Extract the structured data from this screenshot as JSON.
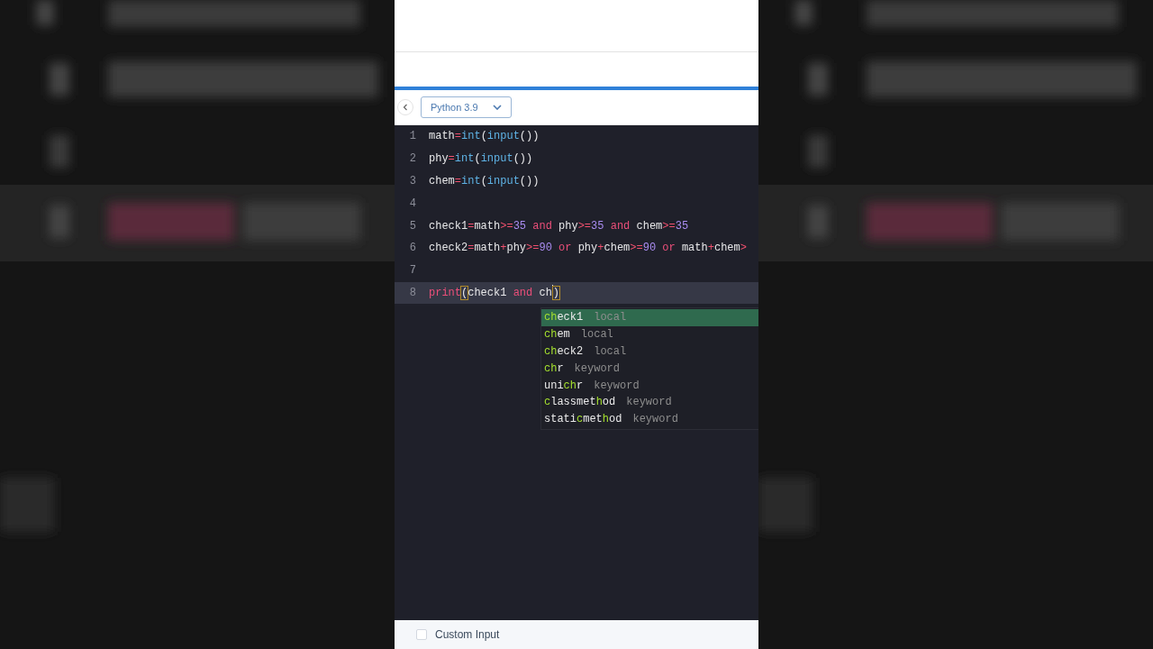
{
  "toolbar": {
    "language": "Python 3.9"
  },
  "editor": {
    "lines": [
      {
        "number": "1",
        "current": false,
        "tokens": [
          {
            "text": "math",
            "kind": "name"
          },
          {
            "text": "=",
            "kind": "op"
          },
          {
            "text": "int",
            "kind": "builtin"
          },
          {
            "text": "(",
            "kind": "paren"
          },
          {
            "text": "input",
            "kind": "builtin"
          },
          {
            "text": "())",
            "kind": "paren"
          }
        ]
      },
      {
        "number": "2",
        "current": false,
        "tokens": [
          {
            "text": "phy",
            "kind": "name"
          },
          {
            "text": "=",
            "kind": "op"
          },
          {
            "text": "int",
            "kind": "builtin"
          },
          {
            "text": "(",
            "kind": "paren"
          },
          {
            "text": "input",
            "kind": "builtin"
          },
          {
            "text": "())",
            "kind": "paren"
          }
        ]
      },
      {
        "number": "3",
        "current": false,
        "tokens": [
          {
            "text": "chem",
            "kind": "name"
          },
          {
            "text": "=",
            "kind": "op"
          },
          {
            "text": "int",
            "kind": "builtin"
          },
          {
            "text": "(",
            "kind": "paren"
          },
          {
            "text": "input",
            "kind": "builtin"
          },
          {
            "text": "())",
            "kind": "paren"
          }
        ]
      },
      {
        "number": "4",
        "current": false
      },
      {
        "number": "5",
        "current": false,
        "tokens": [
          {
            "text": "check1",
            "kind": "name"
          },
          {
            "text": "=",
            "kind": "op"
          },
          {
            "text": "math",
            "kind": "name"
          },
          {
            "text": ">=",
            "kind": "op"
          },
          {
            "text": "35",
            "kind": "number"
          },
          {
            "text": " and ",
            "kind": "keyword"
          },
          {
            "text": "phy",
            "kind": "name"
          },
          {
            "text": ">=",
            "kind": "op"
          },
          {
            "text": "35",
            "kind": "number"
          },
          {
            "text": " and ",
            "kind": "keyword"
          },
          {
            "text": "chem",
            "kind": "name"
          },
          {
            "text": ">=",
            "kind": "op"
          },
          {
            "text": "35",
            "kind": "number"
          }
        ]
      },
      {
        "number": "6",
        "current": false,
        "tokens": [
          {
            "text": "check2",
            "kind": "name"
          },
          {
            "text": "=",
            "kind": "op"
          },
          {
            "text": "math",
            "kind": "name"
          },
          {
            "text": "+",
            "kind": "op"
          },
          {
            "text": "phy",
            "kind": "name"
          },
          {
            "text": ">=",
            "kind": "op"
          },
          {
            "text": "90",
            "kind": "number"
          },
          {
            "text": " or ",
            "kind": "keyword"
          },
          {
            "text": "phy",
            "kind": "name"
          },
          {
            "text": "+",
            "kind": "op"
          },
          {
            "text": "chem",
            "kind": "name"
          },
          {
            "text": ">=",
            "kind": "op"
          },
          {
            "text": "90",
            "kind": "number"
          },
          {
            "text": " or ",
            "kind": "keyword"
          },
          {
            "text": "math",
            "kind": "name"
          },
          {
            "text": "+",
            "kind": "op"
          },
          {
            "text": "chem",
            "kind": "name"
          },
          {
            "text": ">",
            "kind": "op"
          }
        ]
      },
      {
        "number": "7",
        "current": false
      },
      {
        "number": "8",
        "current": true,
        "tokens": [
          {
            "text": "print",
            "kind": "keyword"
          },
          {
            "text": "(",
            "kind": "paren",
            "matched": true
          },
          {
            "text": "check1",
            "kind": "name"
          },
          {
            "text": " and ",
            "kind": "keyword"
          },
          {
            "text": "ch",
            "kind": "name"
          },
          {
            "kind": "cursor"
          },
          {
            "text": ")",
            "kind": "paren",
            "matched": true
          }
        ]
      }
    ]
  },
  "suggestions": [
    {
      "selected": true,
      "parts": [
        {
          "text": "ch",
          "match": true
        },
        {
          "text": "eck1",
          "match": false
        }
      ],
      "type": "local"
    },
    {
      "selected": false,
      "parts": [
        {
          "text": "ch",
          "match": true
        },
        {
          "text": "em",
          "match": false
        }
      ],
      "type": "local"
    },
    {
      "selected": false,
      "parts": [
        {
          "text": "ch",
          "match": true
        },
        {
          "text": "eck2",
          "match": false
        }
      ],
      "type": "local"
    },
    {
      "selected": false,
      "parts": [
        {
          "text": "ch",
          "match": true
        },
        {
          "text": "r",
          "match": false
        }
      ],
      "type": "keyword"
    },
    {
      "selected": false,
      "parts": [
        {
          "text": "uni",
          "match": false
        },
        {
          "text": "ch",
          "match": true
        },
        {
          "text": "r",
          "match": false
        }
      ],
      "type": "keyword"
    },
    {
      "selected": false,
      "parts": [
        {
          "text": "c",
          "match": true
        },
        {
          "text": "lassmet",
          "match": false
        },
        {
          "text": "h",
          "match": true
        },
        {
          "text": "od",
          "match": false
        }
      ],
      "type": "keyword"
    },
    {
      "selected": false,
      "parts": [
        {
          "text": "stati",
          "match": false
        },
        {
          "text": "c",
          "match": true
        },
        {
          "text": "met",
          "match": false
        },
        {
          "text": "h",
          "match": true
        },
        {
          "text": "od",
          "match": false
        }
      ],
      "type": "keyword"
    }
  ],
  "footer": {
    "custom_input": {
      "label": "Custom Input",
      "checked": false
    }
  }
}
